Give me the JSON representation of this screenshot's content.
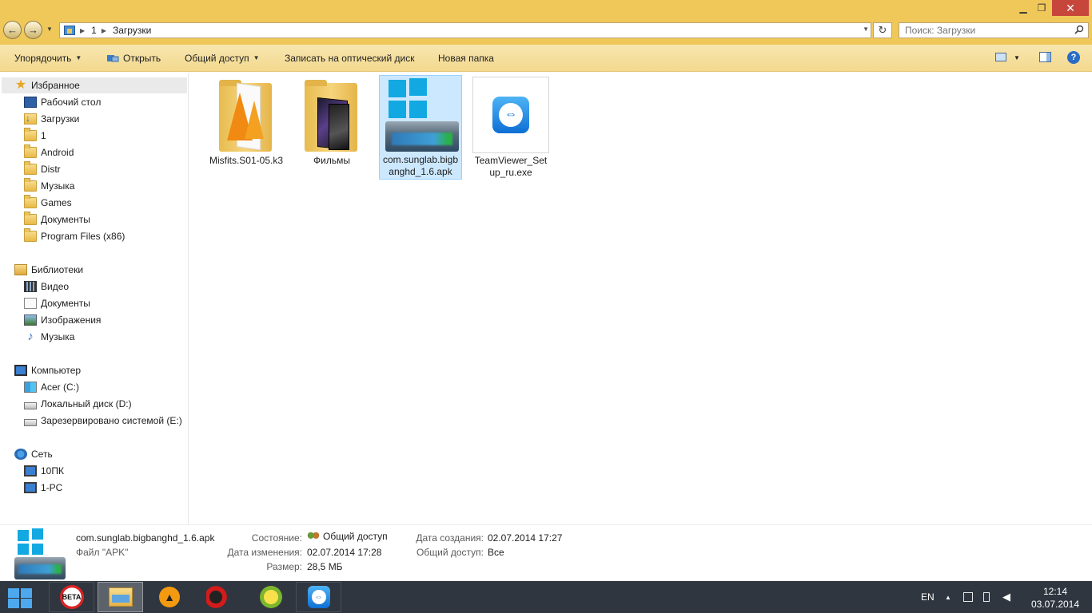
{
  "window": {
    "minimize_glyph": "▁",
    "maximize_glyph": "❐",
    "close_glyph": "✕"
  },
  "address": {
    "segments": [
      "1",
      "Загрузки"
    ]
  },
  "search": {
    "placeholder": "Поиск: Загрузки"
  },
  "toolbar": {
    "organize": "Упорядочить",
    "open": "Открыть",
    "share": "Общий доступ",
    "burn": "Записать на оптический диск",
    "new_folder": "Новая папка",
    "help_glyph": "?"
  },
  "nav": {
    "favorites": {
      "label": "Избранное",
      "items": [
        "Рабочий стол",
        "Загрузки",
        "1",
        "Android",
        "Distr",
        "Музыка",
        "Games",
        "Документы",
        "Program Files (x86)"
      ]
    },
    "libraries": {
      "label": "Библиотеки",
      "items": [
        "Видео",
        "Документы",
        "Изображения",
        "Музыка"
      ]
    },
    "computer": {
      "label": "Компьютер",
      "items": [
        "Acer (C:)",
        "Локальный диск (D:)",
        "Зарезервировано системой (E:)"
      ]
    },
    "network": {
      "label": "Сеть",
      "items": [
        "10ПК",
        "1-PC"
      ]
    }
  },
  "files": [
    {
      "name": "Misfits.S01-05.k3",
      "icon": "folder-vlc-icon",
      "selected": false
    },
    {
      "name": "Фильмы",
      "icon": "folder-films-icon",
      "selected": false
    },
    {
      "name": "com.sunglab.bigbanghd_1.6.apk",
      "icon": "apk-icon",
      "selected": true
    },
    {
      "name": "TeamViewer_Setup_ru.exe",
      "icon": "teamviewer-icon",
      "selected": false
    }
  ],
  "details": {
    "name": "com.sunglab.bigbanghd_1.6.apk",
    "type": "Файл \"APK\"",
    "state_label": "Состояние:",
    "state_value": "Общий доступ",
    "modified_label": "Дата изменения:",
    "modified_value": "02.07.2014 17:28",
    "size_label": "Размер:",
    "size_value": "28,5 МБ",
    "created_label": "Дата создания:",
    "created_value": "02.07.2014 17:27",
    "shared_label": "Общий доступ:",
    "shared_value": "Все"
  },
  "taskbar": {
    "beta_badge": "BETA",
    "language": "EN",
    "time": "12:14",
    "date": "03.07.2014"
  }
}
